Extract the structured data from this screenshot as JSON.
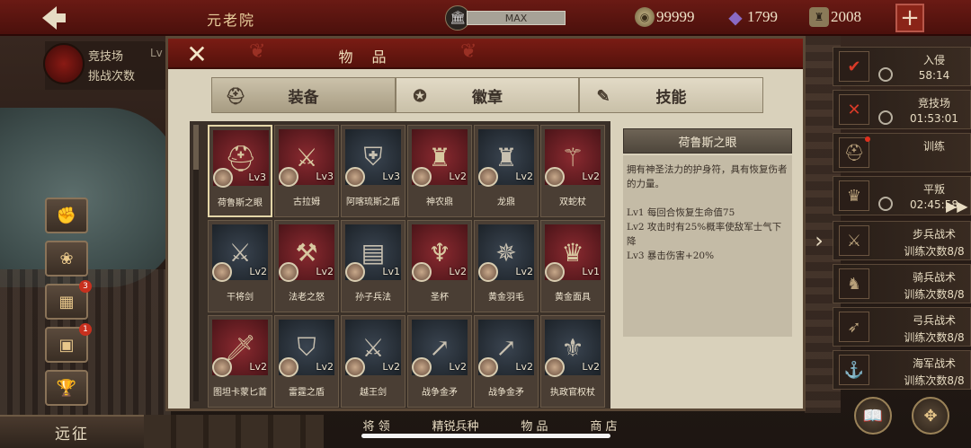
{
  "topbar": {
    "title": "元老院",
    "max_label": "MAX",
    "coins": "99999",
    "gems": "1799",
    "stamina": "2008"
  },
  "left": {
    "arena_label": "竞技场",
    "arena_lv": "Lv",
    "arena_sub": "挑战次数",
    "badges": [
      "3",
      "1"
    ],
    "expedition": "远征"
  },
  "bottom_menu": [
    "将 领",
    "精锐兵种",
    "物 品",
    "商 店"
  ],
  "dialog": {
    "title": "物 品",
    "tabs": [
      {
        "label": "装备",
        "icon": "helmet-icon",
        "active": true
      },
      {
        "label": "徽章",
        "icon": "badge-icon",
        "active": false
      },
      {
        "label": "技能",
        "icon": "scroll-icon",
        "active": false
      }
    ],
    "items": [
      {
        "name": "荷鲁斯之眼",
        "lv": "Lv3",
        "style": "red",
        "glyph": "⛑"
      },
      {
        "name": "古拉姆",
        "lv": "Lv3",
        "style": "red",
        "glyph": "⚔"
      },
      {
        "name": "阿喀琉斯之盾",
        "lv": "Lv3",
        "style": "dark",
        "glyph": "⛨"
      },
      {
        "name": "神农鼎",
        "lv": "Lv2",
        "style": "red",
        "glyph": "♜"
      },
      {
        "name": "龙鼎",
        "lv": "Lv2",
        "style": "dark",
        "glyph": "♜"
      },
      {
        "name": "双蛇杖",
        "lv": "Lv2",
        "style": "red",
        "glyph": "⚚"
      },
      {
        "name": "干将剑",
        "lv": "Lv2",
        "style": "dark",
        "glyph": "⚔"
      },
      {
        "name": "法老之怒",
        "lv": "Lv2",
        "style": "red",
        "glyph": "⚒"
      },
      {
        "name": "孙子兵法",
        "lv": "Lv1",
        "style": "dark",
        "glyph": "▤"
      },
      {
        "name": "圣杯",
        "lv": "Lv2",
        "style": "red",
        "glyph": "♆"
      },
      {
        "name": "黄金羽毛",
        "lv": "Lv2",
        "style": "dark",
        "glyph": "✵"
      },
      {
        "name": "黄金面具",
        "lv": "Lv1",
        "style": "red",
        "glyph": "♛"
      },
      {
        "name": "图坦卡蒙匕首",
        "lv": "Lv2",
        "style": "red",
        "glyph": "🗡"
      },
      {
        "name": "雷霆之盾",
        "lv": "Lv2",
        "style": "dark",
        "glyph": "⛉"
      },
      {
        "name": "越王剑",
        "lv": "Lv2",
        "style": "dark",
        "glyph": "⚔"
      },
      {
        "name": "战争金矛",
        "lv": "Lv2",
        "style": "dark",
        "glyph": "↗"
      },
      {
        "name": "战争金矛",
        "lv": "Lv2",
        "style": "dark",
        "glyph": "↗"
      },
      {
        "name": "执政官权杖",
        "lv": "Lv2",
        "style": "dark",
        "glyph": "⚜"
      }
    ],
    "detail": {
      "name": "荷鲁斯之眼",
      "description": "拥有神圣法力的护身符，具有恢复伤者的力量。",
      "levels": [
        "Lv1  每回合恢复生命值75",
        "Lv2  攻击时有25%概率使敌军士气下降",
        "Lv3  暴击伤害+20%"
      ]
    }
  },
  "tasks": [
    {
      "name": "入侵",
      "time": "58:14",
      "icon": "shield-v-icon",
      "red": true
    },
    {
      "name": "竞技场",
      "time": "01:53:01",
      "icon": "crossed-swords-icon",
      "red": true
    },
    {
      "name": "训练",
      "time": "",
      "icon": "helmet-icon",
      "red": false
    },
    {
      "name": "平叛",
      "time": "02:45:58",
      "icon": "mask-icon",
      "red": false
    },
    {
      "name": "步兵战术",
      "time": "训练次数8/8",
      "icon": "sword-icon",
      "red": false
    },
    {
      "name": "骑兵战术",
      "time": "训练次数8/8",
      "icon": "horse-icon",
      "red": false
    },
    {
      "name": "弓兵战术",
      "time": "训练次数8/8",
      "icon": "bow-icon",
      "red": false
    },
    {
      "name": "海军战术",
      "time": "训练次数8/8",
      "icon": "anchor-icon",
      "red": false
    }
  ]
}
